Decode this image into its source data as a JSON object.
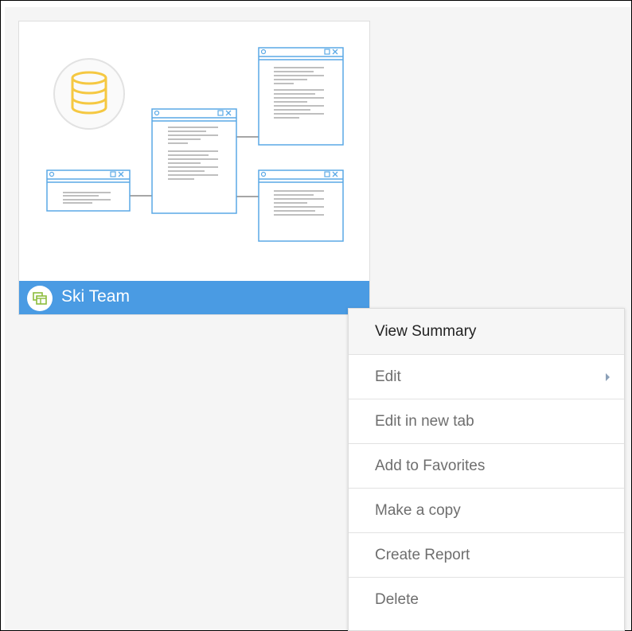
{
  "card": {
    "title": "Ski Team",
    "colors": {
      "title_bar": "#4a9be3",
      "accent_line": "#5aa9e6",
      "database_icon": "#f5c842"
    },
    "title_icon": "view-icon",
    "thumbnail_icons": [
      "database-icon",
      "table-window-icon"
    ]
  },
  "context_menu": {
    "items": [
      {
        "label": "View Summary"
      },
      {
        "label": "Edit",
        "has_submenu": true
      },
      {
        "label": "Edit in new tab"
      },
      {
        "label": "Add to Favorites"
      },
      {
        "label": "Make a copy"
      },
      {
        "label": "Create Report"
      },
      {
        "label": "Delete"
      }
    ]
  }
}
